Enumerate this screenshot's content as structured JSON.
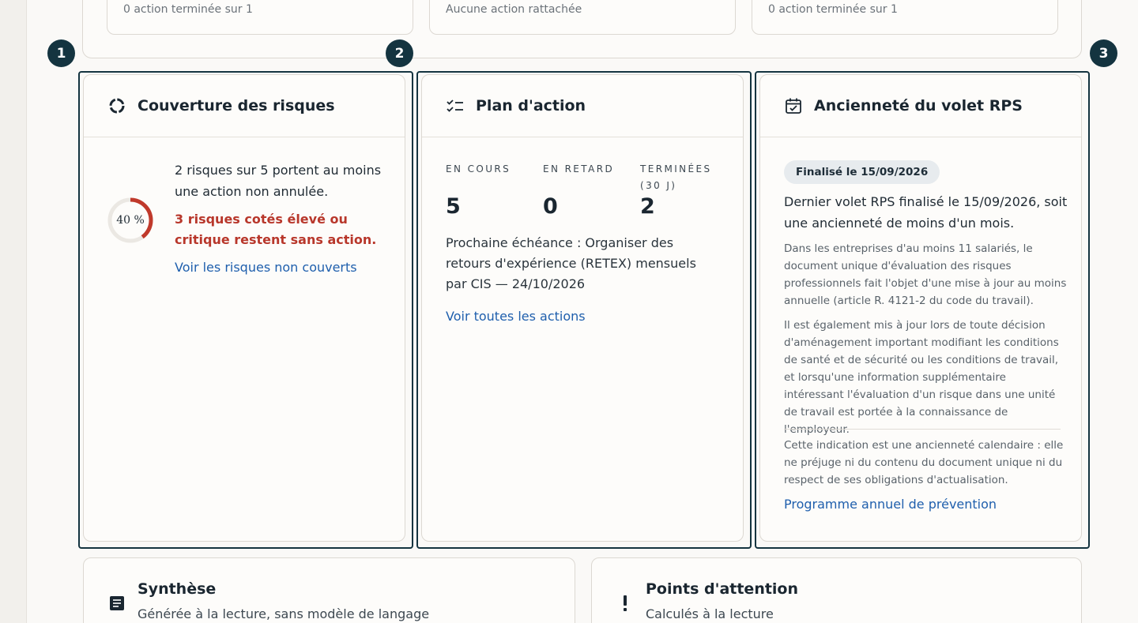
{
  "summary_cards": [
    {
      "text": "0 action terminée sur 1"
    },
    {
      "text": "Aucune action rattachée"
    },
    {
      "text": "0 action terminée sur 1"
    }
  ],
  "markers": [
    "1",
    "2",
    "3"
  ],
  "coverage": {
    "icon": "donut-chart-icon",
    "title": "Couverture des risques",
    "percent_label": "40 %",
    "percent_value": 40,
    "summary": "2 risques sur 5 portent au moins une action non annulée.",
    "alert": "3 risques cotés élevé ou critique restent sans action.",
    "link": "Voir les risques non couverts",
    "colors": {
      "alert": "#b8372b",
      "ring": "#c0392b",
      "ring_track": "#ebe8e3"
    }
  },
  "plan": {
    "icon": "checklist-icon",
    "title": "Plan d'action",
    "stats": [
      {
        "label": "EN COURS",
        "value": "5"
      },
      {
        "label": "EN RETARD",
        "value": "0"
      },
      {
        "label": "TERMINÉES (30 J)",
        "value": "2"
      }
    ],
    "next_deadline": "Prochaine échéance : Organiser des retours d'expérience (RETEX) mensuels par CIS — 24/10/2026",
    "link": "Voir toutes les actions"
  },
  "rps": {
    "icon": "calendar-check-icon",
    "title": "Ancienneté du volet RPS",
    "badge": "Finalisé le 15/09/2026",
    "main": "Dernier volet RPS finalisé le 15/09/2026, soit une ancienneté de moins d'un mois.",
    "para1": "Dans les entreprises d'au moins 11 salariés, le document unique d'évaluation des risques professionnels fait l'objet d'une mise à jour au moins annuelle (article R. 4121-2 du code du travail).",
    "para2": "Il est également mis à jour lors de toute décision d'aménagement important modifiant les conditions de santé et de sécurité ou les conditions de travail, et lorsqu'une information supplémentaire intéressant l'évaluation d'un risque dans une unité de travail est portée à la connaissance de l'employeur.",
    "note": "Cette indication est une ancienneté calendaire : elle ne préjuge ni du contenu du document unique ni du respect de ses obligations d'actualisation.",
    "link": "Programme annuel de prévention"
  },
  "synthese": {
    "icon": "document-icon",
    "title": "Synthèse",
    "subtitle": "Générée à la lecture, sans modèle de langage"
  },
  "attention": {
    "icon": "exclamation-icon",
    "title": "Points d'attention",
    "subtitle": "Calculés à la lecture"
  },
  "colors": {
    "accent": "#143440",
    "link": "#1f5fad"
  }
}
